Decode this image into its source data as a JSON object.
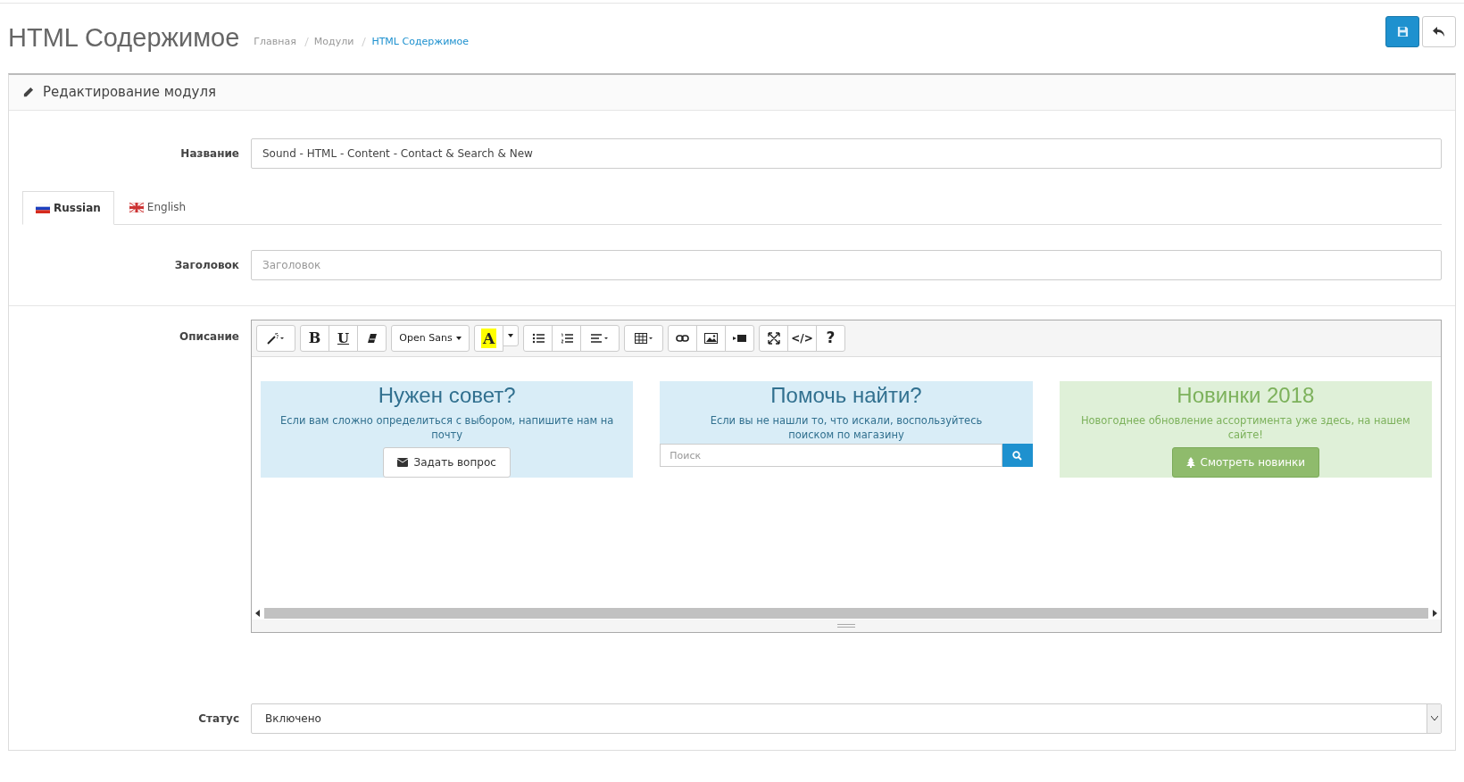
{
  "page_title": "HTML Содержимое",
  "breadcrumbs": [
    {
      "label": "Главная",
      "current": false
    },
    {
      "label": "Модули",
      "current": false
    },
    {
      "label": "HTML Содержимое",
      "current": true
    }
  ],
  "panel": {
    "title": "Редактирование модуля"
  },
  "name_field": {
    "label": "Название",
    "value": "Sound - HTML - Content - Contact & Search & New"
  },
  "tabs": [
    {
      "label": "Russian",
      "selected": true,
      "kind": "ru"
    },
    {
      "label": "English",
      "selected": false,
      "kind": "en"
    }
  ],
  "heading_field": {
    "label": "Заголовок",
    "placeholder": "Заголовок"
  },
  "description": {
    "label": "Описание",
    "toolbar": [
      [
        {
          "kind": "magic"
        }
      ],
      [
        {
          "kind": "bold",
          "label": "B"
        },
        {
          "kind": "underline",
          "label": "U"
        },
        {
          "kind": "eraser"
        }
      ],
      [
        {
          "kind": "font",
          "label": "Open Sans"
        }
      ],
      [
        {
          "kind": "color",
          "label": "A"
        },
        {
          "kind": "caret"
        }
      ],
      [
        {
          "kind": "ul"
        },
        {
          "kind": "ol"
        },
        {
          "kind": "align"
        }
      ],
      [
        {
          "kind": "table"
        }
      ],
      [
        {
          "kind": "link"
        },
        {
          "kind": "image"
        },
        {
          "kind": "video"
        }
      ],
      [
        {
          "kind": "fullscreen"
        },
        {
          "kind": "code",
          "label": "</>"
        },
        {
          "kind": "help",
          "label": "?"
        }
      ]
    ],
    "blocks": [
      {
        "kind": "button",
        "color": "#d9edf7",
        "title": "Нужен совет?",
        "text": "Если вам сложно определиться с выбором, напишите нам на почту",
        "button": "Задать вопрос"
      },
      {
        "kind": "search",
        "color": "#d9edf7",
        "title": "Помочь найти?",
        "text": "Если вы не нашли то, что искали, воспользуйтесь поиском по магазину",
        "placeholder": "Поиск"
      },
      {
        "kind": "green_button",
        "color": "#dff0d8",
        "title": "Новинки 2018",
        "text": "Новогоднее обновление ассортимента уже здесь, на нашем сайте!",
        "button": "Смотреть новинки"
      }
    ]
  },
  "status_field": {
    "label": "Статус",
    "value": "Включено"
  }
}
